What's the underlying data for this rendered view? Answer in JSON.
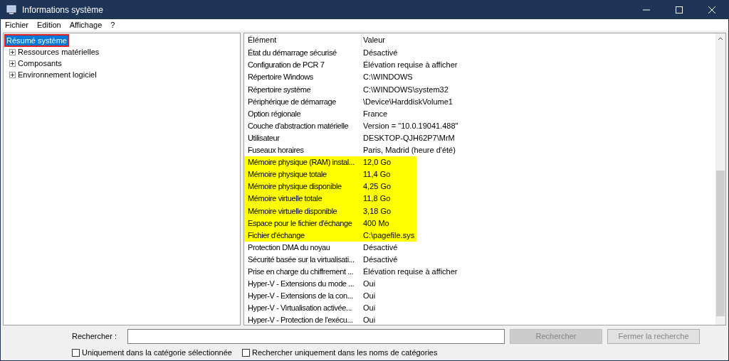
{
  "window": {
    "title": "Informations système"
  },
  "menu": [
    "Fichier",
    "Edition",
    "Affichage",
    "?"
  ],
  "tree": [
    {
      "label": "Résumé système",
      "selected": true,
      "outlined": true
    },
    {
      "label": "Ressources matérielles",
      "selected": false,
      "expanded": false
    },
    {
      "label": "Composants",
      "selected": false,
      "expanded": false
    },
    {
      "label": "Environnement logiciel",
      "selected": false,
      "expanded": false
    }
  ],
  "table": {
    "columns": [
      "Élément",
      "Valeur"
    ],
    "rows": [
      {
        "cells": [
          "État du démarrage sécurisé",
          "Désactivé"
        ],
        "highlighted": false
      },
      {
        "cells": [
          "Configuration de PCR 7",
          "Élévation requise à afficher"
        ],
        "highlighted": false
      },
      {
        "cells": [
          "Répertoire Windows",
          "C:\\WINDOWS"
        ],
        "highlighted": false
      },
      {
        "cells": [
          "Répertoire système",
          "C:\\WINDOWS\\system32"
        ],
        "highlighted": false
      },
      {
        "cells": [
          "Périphérique de démarrage",
          "\\Device\\HarddiskVolume1"
        ],
        "highlighted": false
      },
      {
        "cells": [
          "Option régionale",
          "France"
        ],
        "highlighted": false
      },
      {
        "cells": [
          "Couche d'abstraction matérielle",
          "Version = \"10.0.19041.488\""
        ],
        "highlighted": false
      },
      {
        "cells": [
          "Utilisateur",
          "DESKTOP-QJH62P7\\MrM"
        ],
        "highlighted": false
      },
      {
        "cells": [
          "Fuseaux horaires",
          "Paris, Madrid (heure d'été)"
        ],
        "highlighted": false
      },
      {
        "cells": [
          "Mémoire physique (RAM) instal...",
          "12,0 Go"
        ],
        "highlighted": true
      },
      {
        "cells": [
          "Mémoire physique totale",
          "11,4 Go"
        ],
        "highlighted": true
      },
      {
        "cells": [
          "Mémoire physique disponible",
          "4,25 Go"
        ],
        "highlighted": true
      },
      {
        "cells": [
          "Mémoire virtuelle totale",
          "11,8 Go"
        ],
        "highlighted": true
      },
      {
        "cells": [
          "Mémoire virtuelle disponible",
          "3,18 Go"
        ],
        "highlighted": true
      },
      {
        "cells": [
          "Espace pour le fichier d'échange",
          "400 Mo"
        ],
        "highlighted": true
      },
      {
        "cells": [
          "Fichier d'échange",
          "C:\\pagefile.sys"
        ],
        "highlighted": true
      },
      {
        "cells": [
          "Protection DMA du noyau",
          "Désactivé"
        ],
        "highlighted": false
      },
      {
        "cells": [
          "Sécurité basée sur la virtualisati...",
          "Désactivé"
        ],
        "highlighted": false
      },
      {
        "cells": [
          "Prise en charge du chiffrement ...",
          "Élévation requise à afficher"
        ],
        "highlighted": false
      },
      {
        "cells": [
          "Hyper-V - Extensions du mode ...",
          "Oui"
        ],
        "highlighted": false
      },
      {
        "cells": [
          "Hyper-V - Extensions de la con...",
          "Oui"
        ],
        "highlighted": false
      },
      {
        "cells": [
          "Hyper-V - Virtualisation activée...",
          "Oui"
        ],
        "highlighted": false
      },
      {
        "cells": [
          "Hyper-V - Protection de l'exécu...",
          "Oui"
        ],
        "highlighted": false
      }
    ]
  },
  "search": {
    "label": "Rechercher :",
    "button": "Rechercher",
    "close_button": "Fermer la recherche"
  },
  "options": [
    {
      "label": "Uniquement dans la catégorie sélectionnée",
      "checked": false
    },
    {
      "label": "Rechercher uniquement dans les noms de catégories",
      "checked": false
    }
  ]
}
